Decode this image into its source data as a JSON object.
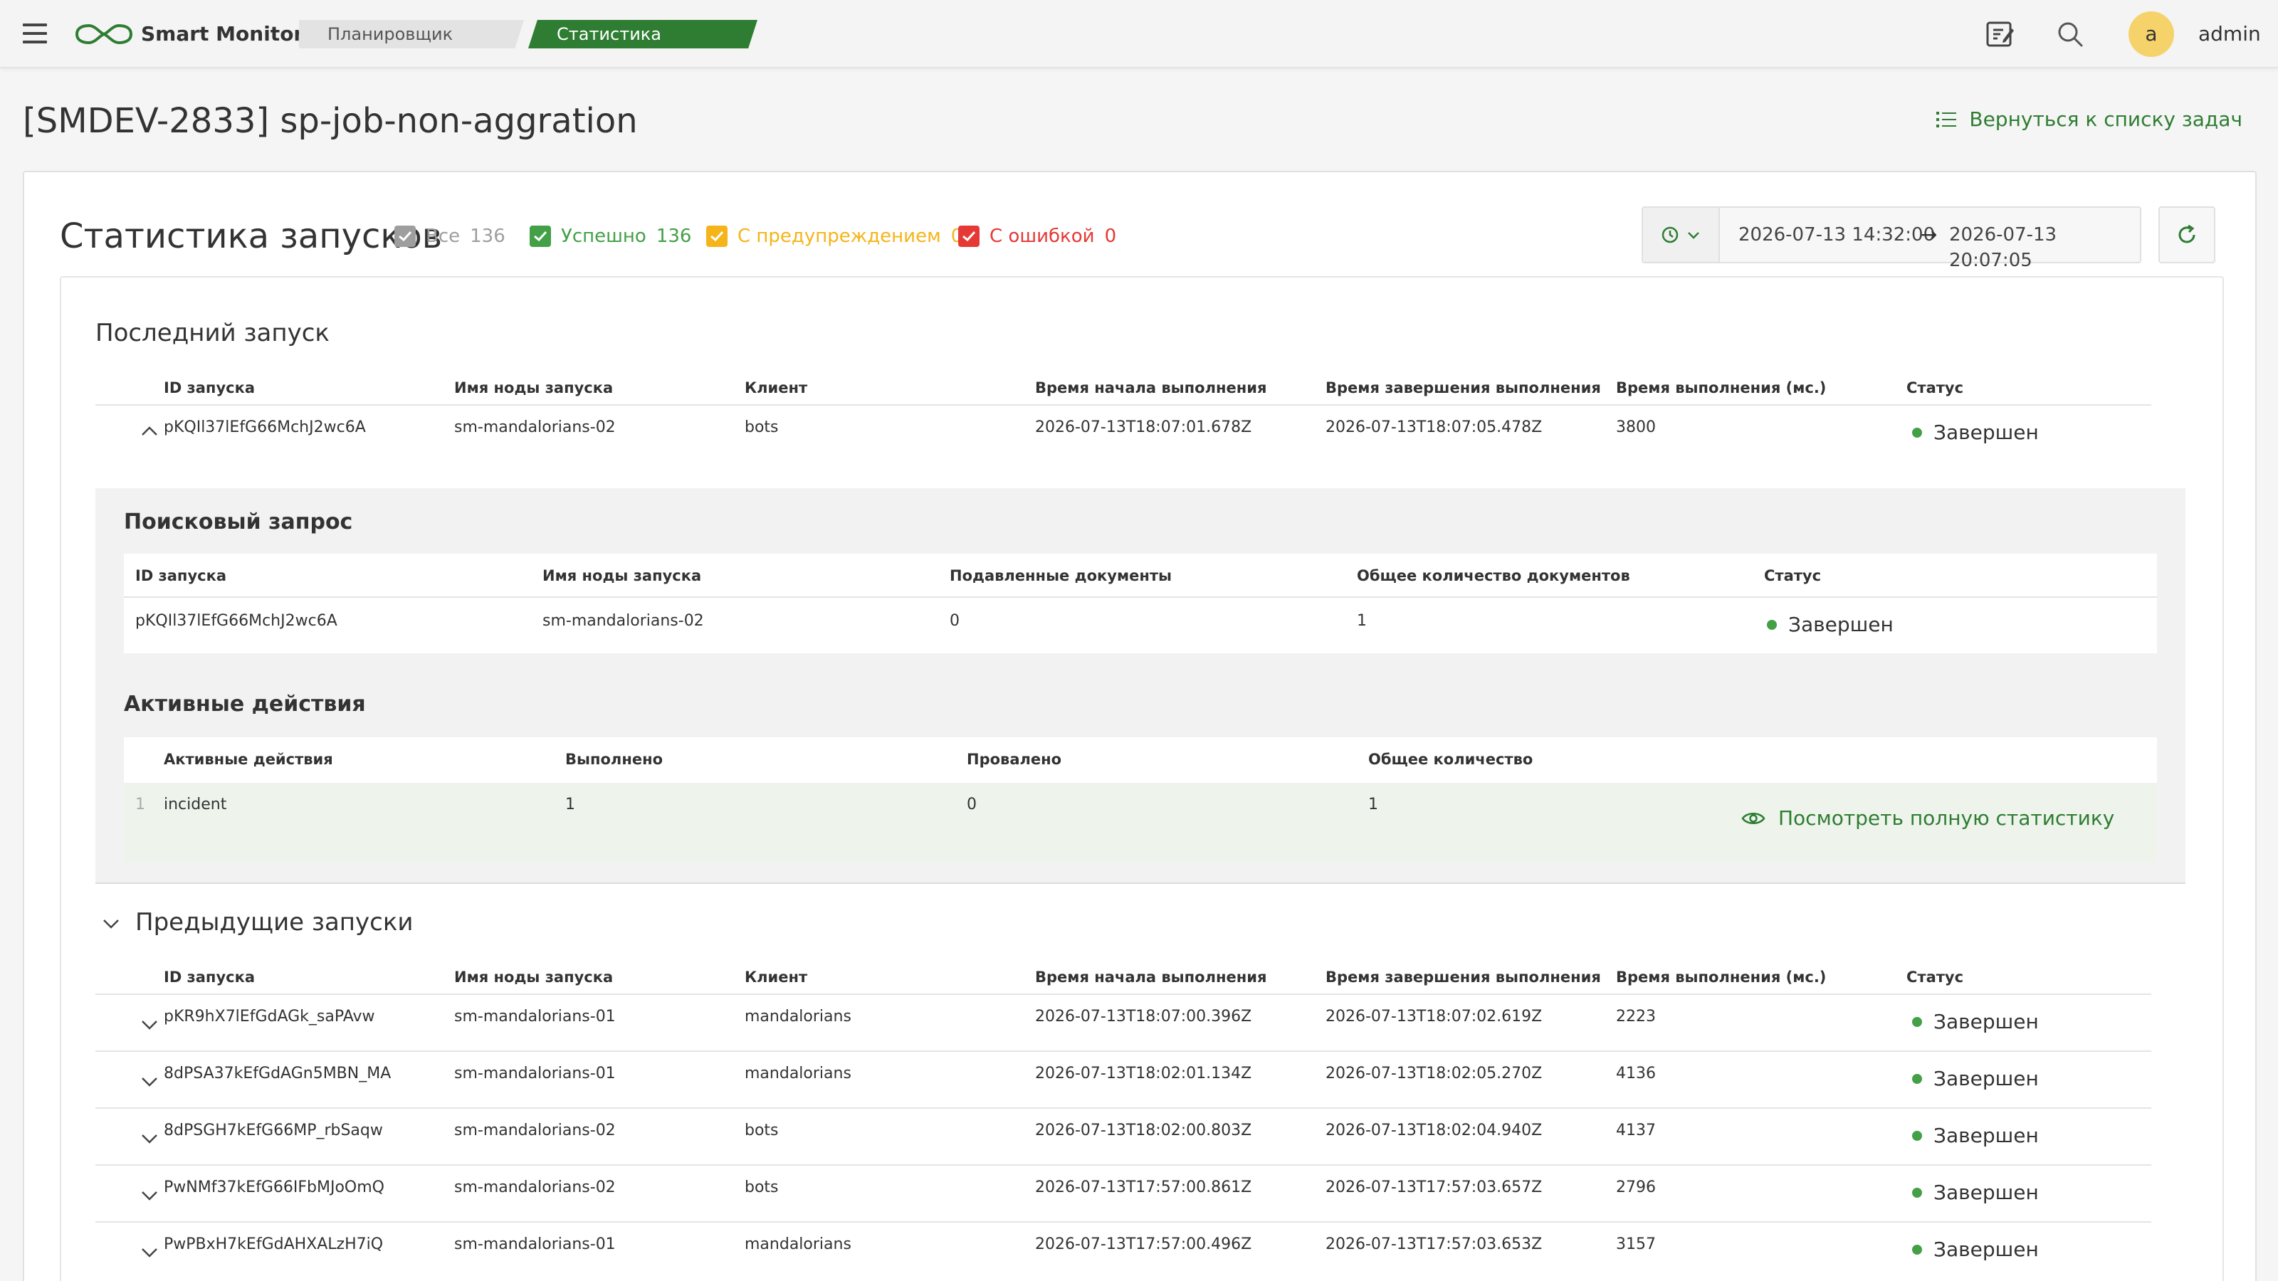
{
  "app": {
    "brand": "Smart Monitor",
    "breadcrumbs": [
      "Планировщик зад...",
      "Статистика запусков"
    ],
    "user": {
      "initial": "a",
      "name": "admin"
    }
  },
  "page": {
    "title": "[SMDEV-2833] sp-job-non-aggration",
    "back_link": "Вернуться к списку задач"
  },
  "stats": {
    "title": "Статистика запусков",
    "filters": [
      {
        "label": "Все",
        "count": "136",
        "color": "#9e9e9e"
      },
      {
        "label": "Успешно",
        "count": "136",
        "color": "#43a047"
      },
      {
        "label": "С предупреждением",
        "count": "0",
        "color": "#f5b41a"
      },
      {
        "label": "С ошибкой",
        "count": "0",
        "color": "#e53935"
      }
    ],
    "date_range": {
      "start": "2026-07-13 14:32:00",
      "arrow": "→",
      "end": "2026-07-13 20:07:05"
    }
  },
  "last_run": {
    "title": "Последний запуск",
    "columns": [
      "ID запуска",
      "Имя ноды запуска",
      "Клиент",
      "Время начала выполнения",
      "Время завершения выполнения",
      "Время выполнения (мс.)",
      "Статус"
    ],
    "row": {
      "id": "pKQIl37lEfG66MchJ2wc6A",
      "node": "sm-mandalorians-02",
      "client": "bots",
      "start": "2026-07-13T18:07:01.678Z",
      "end": "2026-07-13T18:07:05.478Z",
      "duration": "3800",
      "status": "Завершен"
    },
    "search_query": {
      "title": "Поисковый запрос",
      "columns": [
        "ID запуска",
        "Имя ноды запуска",
        "Подавленные документы",
        "Общее количество документов",
        "Статус"
      ],
      "row": {
        "id": "pKQIl37lEfG66MchJ2wc6A",
        "node": "sm-mandalorians-02",
        "suppressed": "0",
        "total": "1",
        "status": "Завершен"
      }
    },
    "active_actions": {
      "title": "Активные действия",
      "columns": [
        "Активные действия",
        "Выполнено",
        "Провалено",
        "Общее количество"
      ],
      "row": {
        "num": "1",
        "action": "incident",
        "done": "1",
        "failed": "0",
        "total": "1"
      },
      "view_link": "Посмотреть полную статистику"
    }
  },
  "previous_runs": {
    "title": "Предыдущие запуски",
    "columns": [
      "ID запуска",
      "Имя ноды запуска",
      "Клиент",
      "Время начала выполнения",
      "Время завершения выполнения",
      "Время выполнения (мс.)",
      "Статус"
    ],
    "rows": [
      {
        "id": "pKR9hX7lEfGdAGk_saPAvw",
        "node": "sm-mandalorians-01",
        "client": "mandalorians",
        "start": "2026-07-13T18:07:00.396Z",
        "end": "2026-07-13T18:07:02.619Z",
        "duration": "2223",
        "status": "Завершен"
      },
      {
        "id": "8dPSA37kEfGdAGn5MBN_MA",
        "node": "sm-mandalorians-01",
        "client": "mandalorians",
        "start": "2026-07-13T18:02:01.134Z",
        "end": "2026-07-13T18:02:05.270Z",
        "duration": "4136",
        "status": "Завершен"
      },
      {
        "id": "8dPSGH7kEfG66MP_rbSaqw",
        "node": "sm-mandalorians-02",
        "client": "bots",
        "start": "2026-07-13T18:02:00.803Z",
        "end": "2026-07-13T18:02:04.940Z",
        "duration": "4137",
        "status": "Завершен"
      },
      {
        "id": "PwNMf37kEfG66IFbMJoOmQ",
        "node": "sm-mandalorians-02",
        "client": "bots",
        "start": "2026-07-13T17:57:00.861Z",
        "end": "2026-07-13T17:57:03.657Z",
        "duration": "2796",
        "status": "Завершен"
      },
      {
        "id": "PwPBxH7kEfGdAHXALzH7iQ",
        "node": "sm-mandalorians-01",
        "client": "mandalorians",
        "start": "2026-07-13T17:57:00.496Z",
        "end": "2026-07-13T17:57:03.653Z",
        "duration": "3157",
        "status": "Завершен"
      }
    ]
  },
  "colors": {
    "accent": "#2e7d32",
    "success_dot": "#43a047"
  }
}
